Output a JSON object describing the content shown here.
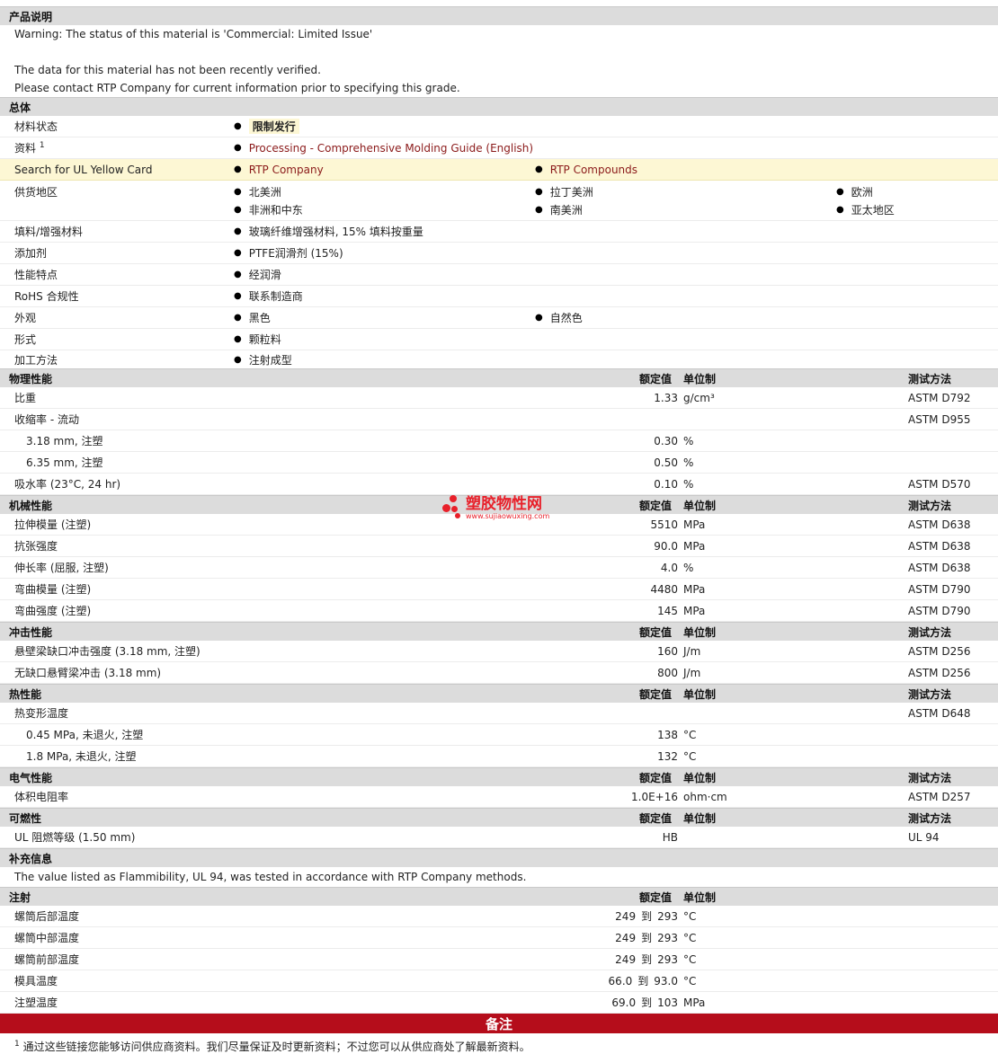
{
  "description": {
    "header": "产品说明",
    "warning": "Warning: The status of this material is 'Commercial: Limited Issue'",
    "note1": "The data for this material has not been recently verified.",
    "note2": "Please contact RTP Company for current information prior to specifying this grade."
  },
  "general": {
    "header": "总体",
    "status_label": "材料状态",
    "status_value": "限制发行",
    "docs_label": "资料",
    "docs_sup": "1",
    "docs_link": "Processing - Comprehensive Molding Guide (English)",
    "ul_label": "Search for UL Yellow Card",
    "ul_link1": "RTP Company",
    "ul_link2": "RTP Compounds",
    "supply_label": "供货地区",
    "supply": [
      "北美洲",
      "拉丁美洲",
      "欧洲",
      "非洲和中东",
      "南美洲",
      "亚太地区"
    ],
    "filler_label": "填料/增强材料",
    "filler_value": "玻璃纤维增强材料, 15% 填料按重量",
    "additive_label": "添加剂",
    "additive_value": "PTFE润滑剂 (15%)",
    "features_label": "性能特点",
    "features_value": "经润滑",
    "rohs_label": "RoHS 合规性",
    "rohs_value": "联系制造商",
    "appearance_label": "外观",
    "appearance_1": "黑色",
    "appearance_2": "自然色",
    "form_label": "形式",
    "form_value": "颗粒料",
    "process_label": "加工方法",
    "process_value": "注射成型"
  },
  "columns": {
    "nominal": "额定值",
    "unit": "单位制",
    "test": "测试方法"
  },
  "physical": {
    "header": "物理性能",
    "rows": [
      {
        "label": "比重",
        "value": "1.33",
        "unit": "g/cm³",
        "test": "ASTM D792"
      },
      {
        "label": "收缩率 - 流动",
        "value": "",
        "unit": "",
        "test": "ASTM D955"
      },
      {
        "label": "3.18 mm, 注塑",
        "value": "0.30",
        "unit": "%",
        "test": ""
      },
      {
        "label": "6.35 mm, 注塑",
        "value": "0.50",
        "unit": "%",
        "test": ""
      },
      {
        "label": "吸水率 (23°C, 24 hr)",
        "value": "0.10",
        "unit": "%",
        "test": "ASTM D570"
      }
    ]
  },
  "mechanical": {
    "header": "机械性能",
    "rows": [
      {
        "label": "拉伸模量 (注塑)",
        "value": "5510",
        "unit": "MPa",
        "test": "ASTM D638"
      },
      {
        "label": "抗张强度",
        "value": "90.0",
        "unit": "MPa",
        "test": "ASTM D638"
      },
      {
        "label": "伸长率 (屈服, 注塑)",
        "value": "4.0",
        "unit": "%",
        "test": "ASTM D638"
      },
      {
        "label": "弯曲模量 (注塑)",
        "value": "4480",
        "unit": "MPa",
        "test": "ASTM D790"
      },
      {
        "label": "弯曲强度 (注塑)",
        "value": "145",
        "unit": "MPa",
        "test": "ASTM D790"
      }
    ]
  },
  "impact": {
    "header": "冲击性能",
    "rows": [
      {
        "label": "悬壁梁缺口冲击强度 (3.18 mm, 注塑)",
        "value": "160",
        "unit": "J/m",
        "test": "ASTM D256"
      },
      {
        "label": "无缺口悬臂梁冲击 (3.18 mm)",
        "value": "800",
        "unit": "J/m",
        "test": "ASTM D256"
      }
    ]
  },
  "thermal": {
    "header": "热性能",
    "rows": [
      {
        "label": "热变形温度",
        "value": "",
        "unit": "",
        "test": "ASTM D648"
      },
      {
        "label": "0.45 MPa, 未退火, 注塑",
        "value": "138",
        "unit": "°C",
        "test": ""
      },
      {
        "label": "1.8 MPa, 未退火, 注塑",
        "value": "132",
        "unit": "°C",
        "test": ""
      }
    ]
  },
  "electrical": {
    "header": "电气性能",
    "rows": [
      {
        "label": "体积电阻率",
        "value": "1.0E+16",
        "unit": "ohm·cm",
        "test": "ASTM D257"
      }
    ]
  },
  "flammability": {
    "header": "可燃性",
    "rows": [
      {
        "label": "UL 阻燃等级 (1.50 mm)",
        "value": "HB",
        "unit": "",
        "test": "UL 94"
      }
    ]
  },
  "supplemental": {
    "header": "补充信息",
    "text": "The value listed as Flammibility, UL 94, was tested in accordance with RTP Company methods."
  },
  "injection": {
    "header": "注射",
    "rows": [
      {
        "label": "螺筒后部温度",
        "low": "249",
        "to": "到",
        "high": "293",
        "unit": "°C"
      },
      {
        "label": "螺筒中部温度",
        "low": "249",
        "to": "到",
        "high": "293",
        "unit": "°C"
      },
      {
        "label": "螺筒前部温度",
        "low": "249",
        "to": "到",
        "high": "293",
        "unit": "°C"
      },
      {
        "label": "模具温度",
        "low": "66.0",
        "to": "到",
        "high": "93.0",
        "unit": "°C"
      },
      {
        "label": "注塑温度",
        "low": "69.0",
        "to": "到",
        "high": "103",
        "unit": "MPa"
      }
    ]
  },
  "notes": {
    "header": "备注",
    "footnote_sup": "1",
    "footnote": "通过这些链接您能够访问供应商资料。我们尽量保证及时更新资料；不过您可以从供应商处了解最新资料。"
  },
  "watermark": {
    "title": "塑胶物性网",
    "url": "www.sujiaowuxing.com",
    "color": "#e8202a"
  }
}
